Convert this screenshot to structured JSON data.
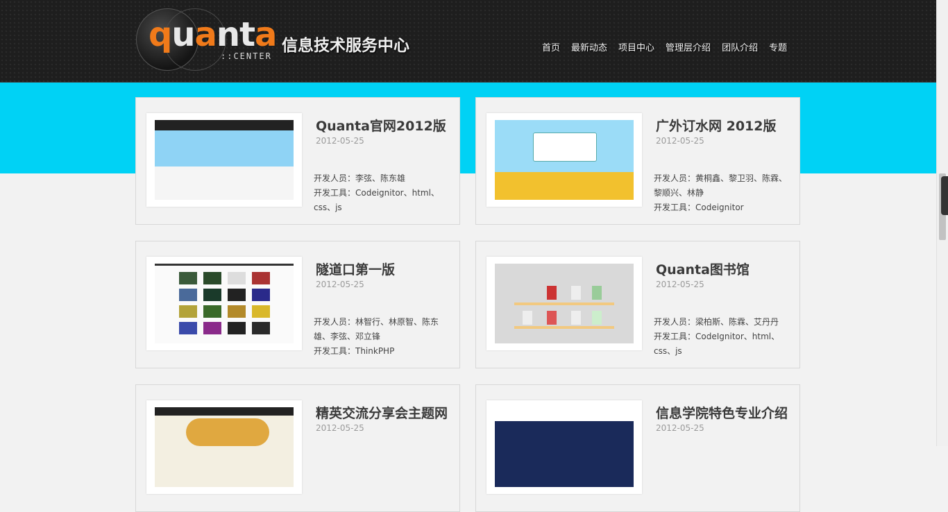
{
  "header": {
    "logo_word": "quanta",
    "logo_sub": "::CENTER",
    "logo_cn": "信息技术服务中心",
    "nav": [
      "首页",
      "最新动态",
      "项目中心",
      "管理层介绍",
      "团队介绍",
      "专题"
    ]
  },
  "projects": [
    {
      "title": "Quanta官网2012版",
      "date": "2012-05-25",
      "info": [
        "开发人员：李弦、陈东雄",
        "开发工具：Codeignitor、html、css、js"
      ]
    },
    {
      "title": "广外订水网 2012版",
      "date": "2012-05-25",
      "info": [
        "开发人员：黄桐鑫、黎卫羽、陈霖、黎顺兴、林静",
        "开发工具：Codeignitor"
      ]
    },
    {
      "title": "隧道口第一版",
      "date": "2012-05-25",
      "info": [
        "开发人员：林智行、林原智、陈东雄、李弦、邓立锋",
        "开发工具：ThinkPHP"
      ]
    },
    {
      "title": "Quanta图书馆",
      "date": "2012-05-25",
      "info": [
        "开发人员：梁柏斯、陈霖、艾丹丹",
        "开发工具：CodeIgnitor、html、css、js"
      ]
    },
    {
      "title": "精英交流分享会主题网",
      "date": "2012-05-25",
      "info": []
    },
    {
      "title": "信息学院特色专业介绍",
      "date": "2012-05-25",
      "info": []
    }
  ],
  "colors": {
    "band": "#00d2f5",
    "header_bg": "#1e1e1e",
    "logo_accent": "#f07a1a"
  }
}
